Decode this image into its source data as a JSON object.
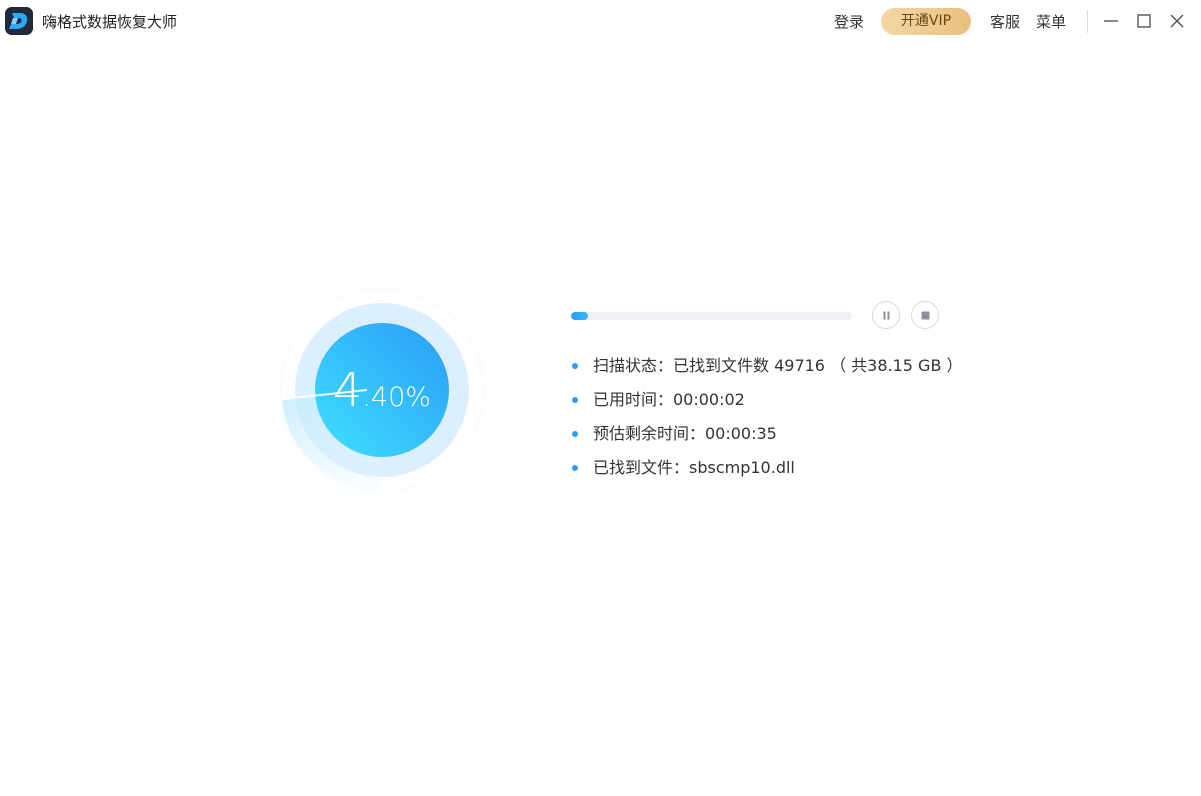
{
  "app": {
    "title": "嗨格式数据恢复大师",
    "logo_icon": "d-letter-logo-icon"
  },
  "header": {
    "login": "登录",
    "vip": "开通VIP",
    "service": "客服",
    "menu": "菜单"
  },
  "window_controls": [
    "minimize-icon",
    "maximize-icon",
    "close-icon"
  ],
  "scan": {
    "percent": 4.4,
    "percent_int": "4",
    "percent_frac": ".40%",
    "bar_progress": 0.06,
    "info": [
      "扫描状态：已找到文件数 49716 （ 共38.15 GB ）",
      "已用时间：00:00:02",
      "预估剩余时间：00:00:35",
      "已找到文件：sbscmp10.dll"
    ]
  },
  "colors": {
    "accent": "#2b9cf7",
    "vip_gold": "#e8c07e",
    "ring_light": "#dcefff"
  }
}
